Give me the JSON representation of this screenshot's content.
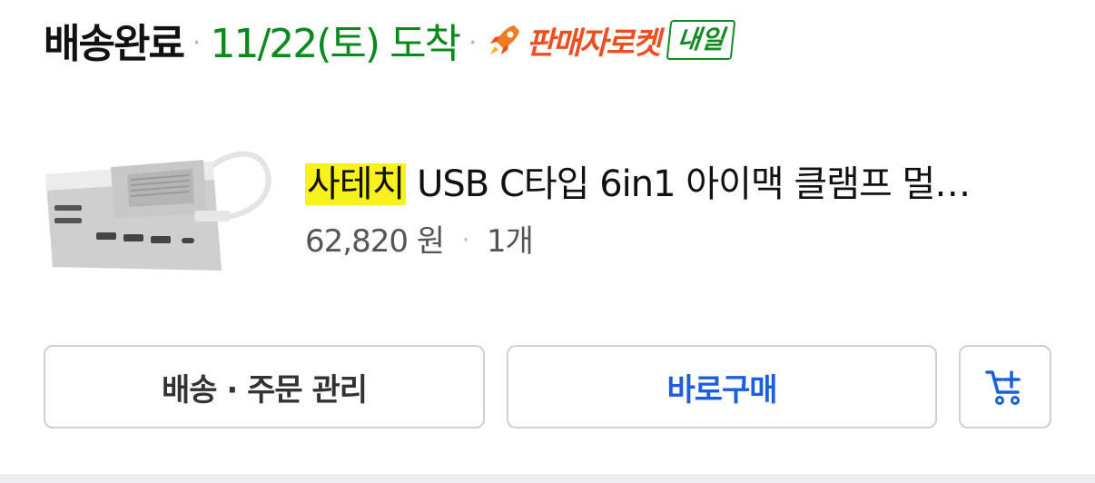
{
  "order": {
    "status": "배송완료",
    "separator": "·",
    "arrival": "11/22(토) 도착",
    "rocket_label": "판매자로켓",
    "rocket_icon": "rocket-icon",
    "tomorrow_badge": "내일"
  },
  "product": {
    "image": "usb-c-hub-product-image",
    "brand": "사테치",
    "title_rest": " USB C타입 6in1 아이맥 클램프 멀…",
    "price": "62,820 원",
    "price_separator": "·",
    "quantity": "1개"
  },
  "actions": {
    "manage_label": "배송 · 주문 관리",
    "buy_label": "바로구매",
    "cart_icon": "add-to-cart-icon"
  },
  "colors": {
    "arrival_green": "#0a8a1c",
    "rocket_orange": "#ef4f1f",
    "buy_blue": "#1b5fe0",
    "brand_highlight": "#f7f21c"
  }
}
